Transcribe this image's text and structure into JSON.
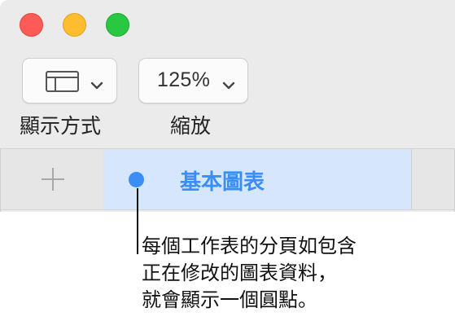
{
  "window": {
    "traffic_lights": [
      "close",
      "minimize",
      "zoom"
    ],
    "colors": {
      "close": "#fd5b57",
      "minimize": "#fdbd2f",
      "zoom": "#28c840"
    }
  },
  "toolbar": {
    "view_button": {
      "icon": "sidebar-layout-icon",
      "label": "顯示方式"
    },
    "zoom_button": {
      "value": "125%",
      "label": "縮放"
    }
  },
  "tabs": {
    "add_icon": "plus-icon",
    "sheets": [
      {
        "label": "基本圖表",
        "selected": true,
        "has_dot": true
      }
    ],
    "accent": "#3a8ef6",
    "selected_bg": "#d6e7fd"
  },
  "callout": {
    "lines": [
      "每個工作表的分頁如包含",
      "正在修改的圖表資料，",
      "就會顯示一個圓點。"
    ]
  }
}
